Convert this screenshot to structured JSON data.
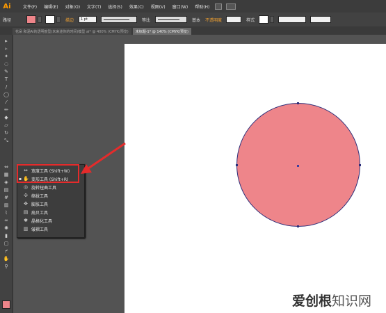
{
  "app": {
    "logo": "Ai"
  },
  "menubar": {
    "items": [
      "文件(F)",
      "编辑(E)",
      "对象(O)",
      "文字(T)",
      "选择(S)",
      "效果(C)",
      "视图(V)",
      "窗口(W)",
      "帮助(H)"
    ]
  },
  "control_bar": {
    "label_path": "路径",
    "fill_color": "#ee858a",
    "stroke_label": "描边",
    "stroke_value": "1 pt",
    "profile_label": "等比",
    "brush_label": "基本",
    "opacity_label": "不透明度",
    "style_label": "样式"
  },
  "tabs": [
    {
      "label": "花朵 和涵AI的透明度型(未来迷你的时间)模型 ai* @ 400% (CMYK/预览)",
      "active": false
    },
    {
      "label": "未标题-1* @ 140% (CMYK/预览)",
      "active": true
    }
  ],
  "flyout": {
    "items": [
      {
        "label": "宽度工具 (Shift+W)",
        "icon": "width-tool-icon",
        "selected": false
      },
      {
        "label": "变形工具 (Shift+R)",
        "icon": "warp-tool-icon",
        "selected": true
      },
      {
        "label": "旋转扭曲工具",
        "icon": "twirl-tool-icon",
        "selected": false
      },
      {
        "label": "缩拢工具",
        "icon": "pucker-tool-icon",
        "selected": false
      },
      {
        "label": "膨胀工具",
        "icon": "bloat-tool-icon",
        "selected": false
      },
      {
        "label": "扇贝工具",
        "icon": "scallop-tool-icon",
        "selected": false
      },
      {
        "label": "晶格化工具",
        "icon": "crystallize-tool-icon",
        "selected": false
      },
      {
        "label": "皱褶工具",
        "icon": "wrinkle-tool-icon",
        "selected": false
      }
    ]
  },
  "artwork": {
    "circle_fill": "#ee858a",
    "circle_stroke": "#2d2f7a"
  },
  "watermark": {
    "text_main": "爱创根",
    "text_sub": "知识网"
  }
}
